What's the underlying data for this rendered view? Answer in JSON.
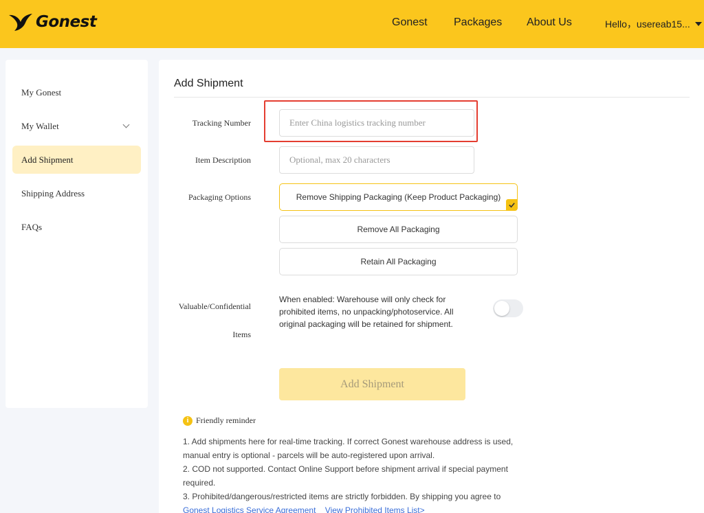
{
  "header": {
    "logo_text": "Gonest",
    "nav": [
      "Gonest",
      "Packages",
      "About Us"
    ],
    "greeting": "Hello，usereab15..."
  },
  "sidebar": {
    "items": [
      {
        "label": "My Gonest"
      },
      {
        "label": "My Wallet"
      },
      {
        "label": "Add Shipment"
      },
      {
        "label": "Shipping Address"
      },
      {
        "label": "FAQs"
      }
    ],
    "active": "Add Shipment"
  },
  "main": {
    "title": "Add Shipment",
    "tracking": {
      "label": "Tracking Number",
      "placeholder": "Enter China logistics tracking number",
      "value": ""
    },
    "description": {
      "label": "Item Description",
      "placeholder": "Optional, max 20 characters",
      "value": ""
    },
    "packaging": {
      "label": "Packaging Options",
      "options": [
        "Remove Shipping Packaging (Keep Product Packaging)",
        "Remove All Packaging",
        "Retain All Packaging"
      ],
      "selected": "Remove Shipping Packaging (Keep Product Packaging)"
    },
    "valuable": {
      "label_line1": "Valuable/Confidential",
      "label_line2": "Items",
      "description": "When enabled: Warehouse will only check for prohibited items, no unpacking/photoservice. All original packaging will be retained for shipment.",
      "enabled": false
    },
    "submit_label": "Add Shipment",
    "reminder": {
      "title": "Friendly reminder",
      "icon": "info-icon",
      "line1": "1. Add shipments here for real-time tracking. If correct Gonest warehouse address is used, manual entry is optional - parcels will be auto-registered upon arrival.",
      "line2": "2. COD not supported. Contact Online Support before shipment arrival if special payment required.",
      "line3": "3. Prohibited/dangerous/restricted items are strictly forbidden. By shipping you agree to",
      "link1": "Gonest Logistics Service Agreement",
      "link2": "View Prohibited Items List>"
    }
  },
  "colors": {
    "brand_yellow": "#fbc61d",
    "active_bg": "#fff0c4",
    "highlight_red": "#e43d30",
    "link_blue": "#3a6ed8"
  }
}
